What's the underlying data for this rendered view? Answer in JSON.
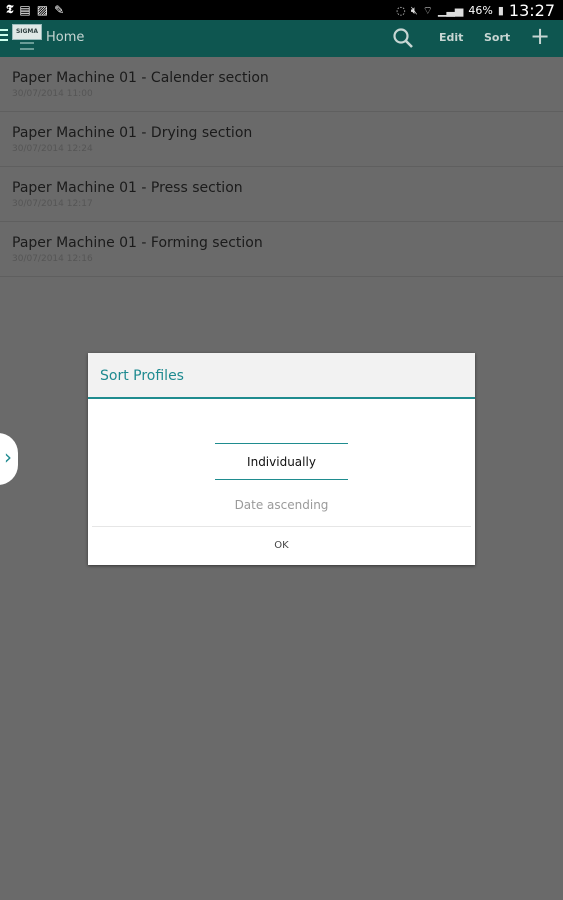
{
  "status_bar": {
    "left_icons": [
      "nyt-icon",
      "document-icon",
      "image-icon",
      "pencil-icon"
    ],
    "battery_percent": "46%",
    "time": "13:27"
  },
  "action_bar": {
    "title": "Home",
    "logo_text": "SIGMA",
    "edit_label": "Edit",
    "sort_label": "Sort",
    "add_label": "+"
  },
  "profiles": [
    {
      "title": "Paper Machine 01 - Calender section",
      "date": "30/07/2014 11:00"
    },
    {
      "title": "Paper Machine 01 - Drying section",
      "date": "30/07/2014 12:24"
    },
    {
      "title": "Paper Machine 01 - Press section",
      "date": "30/07/2014 12:17"
    },
    {
      "title": "Paper Machine 01 - Forming section",
      "date": "30/07/2014 12:16"
    }
  ],
  "dialog": {
    "title": "Sort Profiles",
    "selected_option": "Individually",
    "next_option": "Date ascending",
    "ok_label": "OK"
  },
  "colors": {
    "accent": "#1e8a90",
    "action_bar": "#0e5650",
    "dim_background": "#6a6a6a"
  }
}
